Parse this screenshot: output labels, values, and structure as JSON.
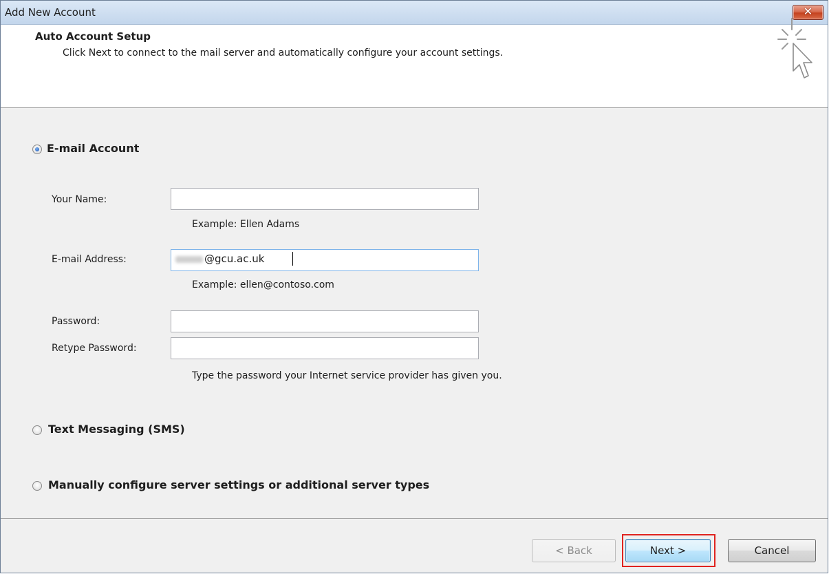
{
  "window": {
    "title": "Add New Account",
    "close_glyph": "✕"
  },
  "header": {
    "title": "Auto Account Setup",
    "description": "Click Next to connect to the mail server and automatically configure your account settings.",
    "icon": "wizard-cursor-icon"
  },
  "options": {
    "email_account": {
      "label": "E-mail Account",
      "selected": true
    },
    "sms": {
      "label": "Text Messaging (SMS)",
      "selected": false
    },
    "manual": {
      "label": "Manually configure server settings or additional server types",
      "selected": false
    }
  },
  "form": {
    "name_label": "Your Name:",
    "name_value": "",
    "name_example": "Example: Ellen Adams",
    "email_label": "E-mail Address:",
    "email_value": "@gcu.ac.uk",
    "email_example": "Example: ellen@contoso.com",
    "password_label": "Password:",
    "retype_label": "Retype Password:",
    "password_hint": "Type the password your Internet service provider has given you."
  },
  "buttons": {
    "back": "< Back",
    "next": "Next >",
    "cancel": "Cancel"
  },
  "colors": {
    "highlight": "#e0231f",
    "close_button": "#c5431f"
  }
}
